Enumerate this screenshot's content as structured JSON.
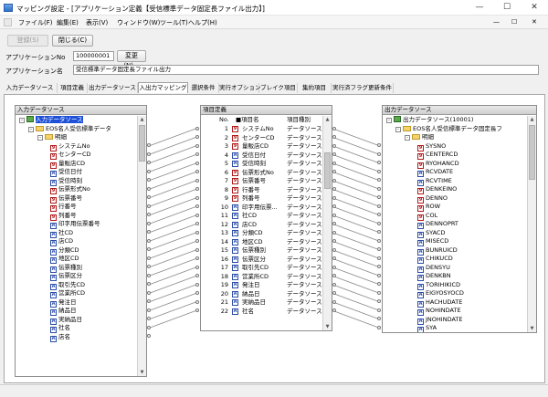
{
  "window": {
    "title": "マッピング設定 - [アプリケーション定義【受信標準データ固定長ファイル出力】]",
    "minimize": "—",
    "maximize": "☐",
    "close": "✕"
  },
  "menu": {
    "items": [
      "ファイル(F)",
      "編集(E)",
      "表示(V)",
      "ウィンドウ(W)",
      "ツール(T)",
      "ヘルプ(H)"
    ],
    "right_min": "—",
    "right_max": "☐",
    "right_close": "✕"
  },
  "toolbar": {
    "save_label": "登録(S)",
    "close_label": "閉じる(C)"
  },
  "form": {
    "appno_label": "アプリケーションNo",
    "appno_value": "100000001",
    "change_label": "変更(N)...",
    "appname_label": "アプリケーション名",
    "appname_value": "受信標準データ固定長ファイル出力"
  },
  "tabs": [
    "入力データソース",
    "項目定義",
    "出力データソース",
    "入出力マッピング",
    "選択条件",
    "実行オプション",
    "ブレイク項目",
    "集約項目",
    "実行済フラグ更新条件"
  ],
  "active_tab": 3,
  "input_panel": {
    "header": "入力データソース",
    "root": "入力データソース",
    "node1": "EOS名人受信標準データ",
    "node2": "明細",
    "items": [
      {
        "icon": "red",
        "label": "システムNo"
      },
      {
        "icon": "red",
        "label": "センターCD"
      },
      {
        "icon": "red",
        "label": "量販店CD"
      },
      {
        "icon": "blue",
        "label": "受信日付"
      },
      {
        "icon": "blue",
        "label": "受信時刻"
      },
      {
        "icon": "red",
        "label": "伝票形式No"
      },
      {
        "icon": "red",
        "label": "伝票番号"
      },
      {
        "icon": "red",
        "label": "行番号"
      },
      {
        "icon": "red",
        "label": "列番号"
      },
      {
        "icon": "blue",
        "label": "印字用伝票番号"
      },
      {
        "icon": "blue",
        "label": "社CD"
      },
      {
        "icon": "blue",
        "label": "店CD"
      },
      {
        "icon": "blue",
        "label": "分類CD"
      },
      {
        "icon": "blue",
        "label": "地区CD"
      },
      {
        "icon": "blue",
        "label": "伝票種別"
      },
      {
        "icon": "blue",
        "label": "伝票区分"
      },
      {
        "icon": "blue",
        "label": "取引先CD"
      },
      {
        "icon": "blue",
        "label": "営業所CD"
      },
      {
        "icon": "blue",
        "label": "発注日"
      },
      {
        "icon": "blue",
        "label": "納品日"
      },
      {
        "icon": "blue",
        "label": "実納品日"
      },
      {
        "icon": "blue",
        "label": "社名"
      },
      {
        "icon": "blue",
        "label": "店名"
      }
    ]
  },
  "item_panel": {
    "header": "項目定義",
    "col_no": "No.",
    "col_name": "■項目名",
    "col_type": "項目種別",
    "rows": [
      {
        "no": "1",
        "icon": "red",
        "name": "システムNo",
        "type": "データソース"
      },
      {
        "no": "2",
        "icon": "red",
        "name": "センターCD",
        "type": "データソース"
      },
      {
        "no": "3",
        "icon": "red",
        "name": "量販店CD",
        "type": "データソース"
      },
      {
        "no": "4",
        "icon": "blue",
        "name": "受信日付",
        "type": "データソース"
      },
      {
        "no": "5",
        "icon": "blue",
        "name": "受信時刻",
        "type": "データソース"
      },
      {
        "no": "6",
        "icon": "red",
        "name": "伝票形式No",
        "type": "データソース"
      },
      {
        "no": "7",
        "icon": "red",
        "name": "伝票番号",
        "type": "データソース"
      },
      {
        "no": "8",
        "icon": "red",
        "name": "行番号",
        "type": "データソース"
      },
      {
        "no": "9",
        "icon": "red",
        "name": "列番号",
        "type": "データソース"
      },
      {
        "no": "10",
        "icon": "blue",
        "name": "印字用伝票...",
        "type": "データソース"
      },
      {
        "no": "11",
        "icon": "blue",
        "name": "社CD",
        "type": "データソース"
      },
      {
        "no": "12",
        "icon": "blue",
        "name": "店CD",
        "type": "データソース"
      },
      {
        "no": "13",
        "icon": "blue",
        "name": "分類CD",
        "type": "データソース"
      },
      {
        "no": "14",
        "icon": "blue",
        "name": "地区CD",
        "type": "データソース"
      },
      {
        "no": "15",
        "icon": "blue",
        "name": "伝票種別",
        "type": "データソース"
      },
      {
        "no": "16",
        "icon": "blue",
        "name": "伝票区分",
        "type": "データソース"
      },
      {
        "no": "17",
        "icon": "blue",
        "name": "取引先CD",
        "type": "データソース"
      },
      {
        "no": "18",
        "icon": "blue",
        "name": "営業所CD",
        "type": "データソース"
      },
      {
        "no": "19",
        "icon": "blue",
        "name": "発注日",
        "type": "データソース"
      },
      {
        "no": "20",
        "icon": "blue",
        "name": "納品日",
        "type": "データソース"
      },
      {
        "no": "21",
        "icon": "blue",
        "name": "実納品日",
        "type": "データソース"
      },
      {
        "no": "22",
        "icon": "blue",
        "name": "社名",
        "type": "データソース"
      }
    ]
  },
  "output_panel": {
    "header": "出力データソース",
    "root": "出力データソース(10001)",
    "node1": "EOS名人受信標準データ固定長フ",
    "node2": "明細",
    "items": [
      {
        "icon": "red",
        "label": "SYSNO"
      },
      {
        "icon": "red",
        "label": "CENTERCD"
      },
      {
        "icon": "red",
        "label": "RYOHANCD"
      },
      {
        "icon": "blue",
        "label": "RCVDATE"
      },
      {
        "icon": "blue",
        "label": "RCVTIME"
      },
      {
        "icon": "red",
        "label": "DENKEINO"
      },
      {
        "icon": "red",
        "label": "DENNO"
      },
      {
        "icon": "red",
        "label": "ROW"
      },
      {
        "icon": "red",
        "label": "COL"
      },
      {
        "icon": "blue",
        "label": "DENNOPRT"
      },
      {
        "icon": "blue",
        "label": "SYACD"
      },
      {
        "icon": "blue",
        "label": "MISECD"
      },
      {
        "icon": "blue",
        "label": "BUNRUICD"
      },
      {
        "icon": "blue",
        "label": "CHIKUCD"
      },
      {
        "icon": "blue",
        "label": "DENSYU"
      },
      {
        "icon": "blue",
        "label": "DENKBN"
      },
      {
        "icon": "blue",
        "label": "TORIHIKICD"
      },
      {
        "icon": "blue",
        "label": "EIGYOSYOCD"
      },
      {
        "icon": "blue",
        "label": "HACHUDATE"
      },
      {
        "icon": "blue",
        "label": "NOHINDATE"
      },
      {
        "icon": "blue",
        "label": "JNOHINDATE"
      },
      {
        "icon": "blue",
        "label": "SYA"
      }
    ]
  }
}
